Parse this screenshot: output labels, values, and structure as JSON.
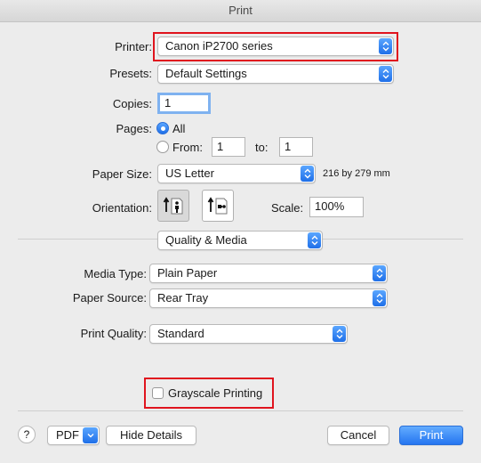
{
  "window": {
    "title": "Print"
  },
  "printer": {
    "label": "Printer:",
    "value": "Canon iP2700 series"
  },
  "presets": {
    "label": "Presets:",
    "value": "Default Settings"
  },
  "copies": {
    "label": "Copies:",
    "value": "1"
  },
  "pages": {
    "label": "Pages:",
    "all_label": "All",
    "from_label": "From:",
    "from_value": "1",
    "to_label": "to:",
    "to_value": "1"
  },
  "paper_size": {
    "label": "Paper Size:",
    "value": "US Letter",
    "dimensions": "216 by 279 mm"
  },
  "orientation": {
    "label": "Orientation:",
    "selected": "portrait"
  },
  "scale": {
    "label": "Scale:",
    "value": "100%"
  },
  "section_popup": {
    "value": "Quality & Media"
  },
  "media_type": {
    "label": "Media Type:",
    "value": "Plain Paper"
  },
  "paper_source": {
    "label": "Paper Source:",
    "value": "Rear Tray"
  },
  "print_quality": {
    "label": "Print Quality:",
    "value": "Standard"
  },
  "grayscale": {
    "label": "Grayscale Printing",
    "checked": false
  },
  "footer": {
    "help": "?",
    "pdf": "PDF",
    "hide_details": "Hide Details",
    "cancel": "Cancel",
    "print": "Print"
  },
  "colors": {
    "accent": "#2475f0",
    "highlight_border": "#e0141e"
  }
}
